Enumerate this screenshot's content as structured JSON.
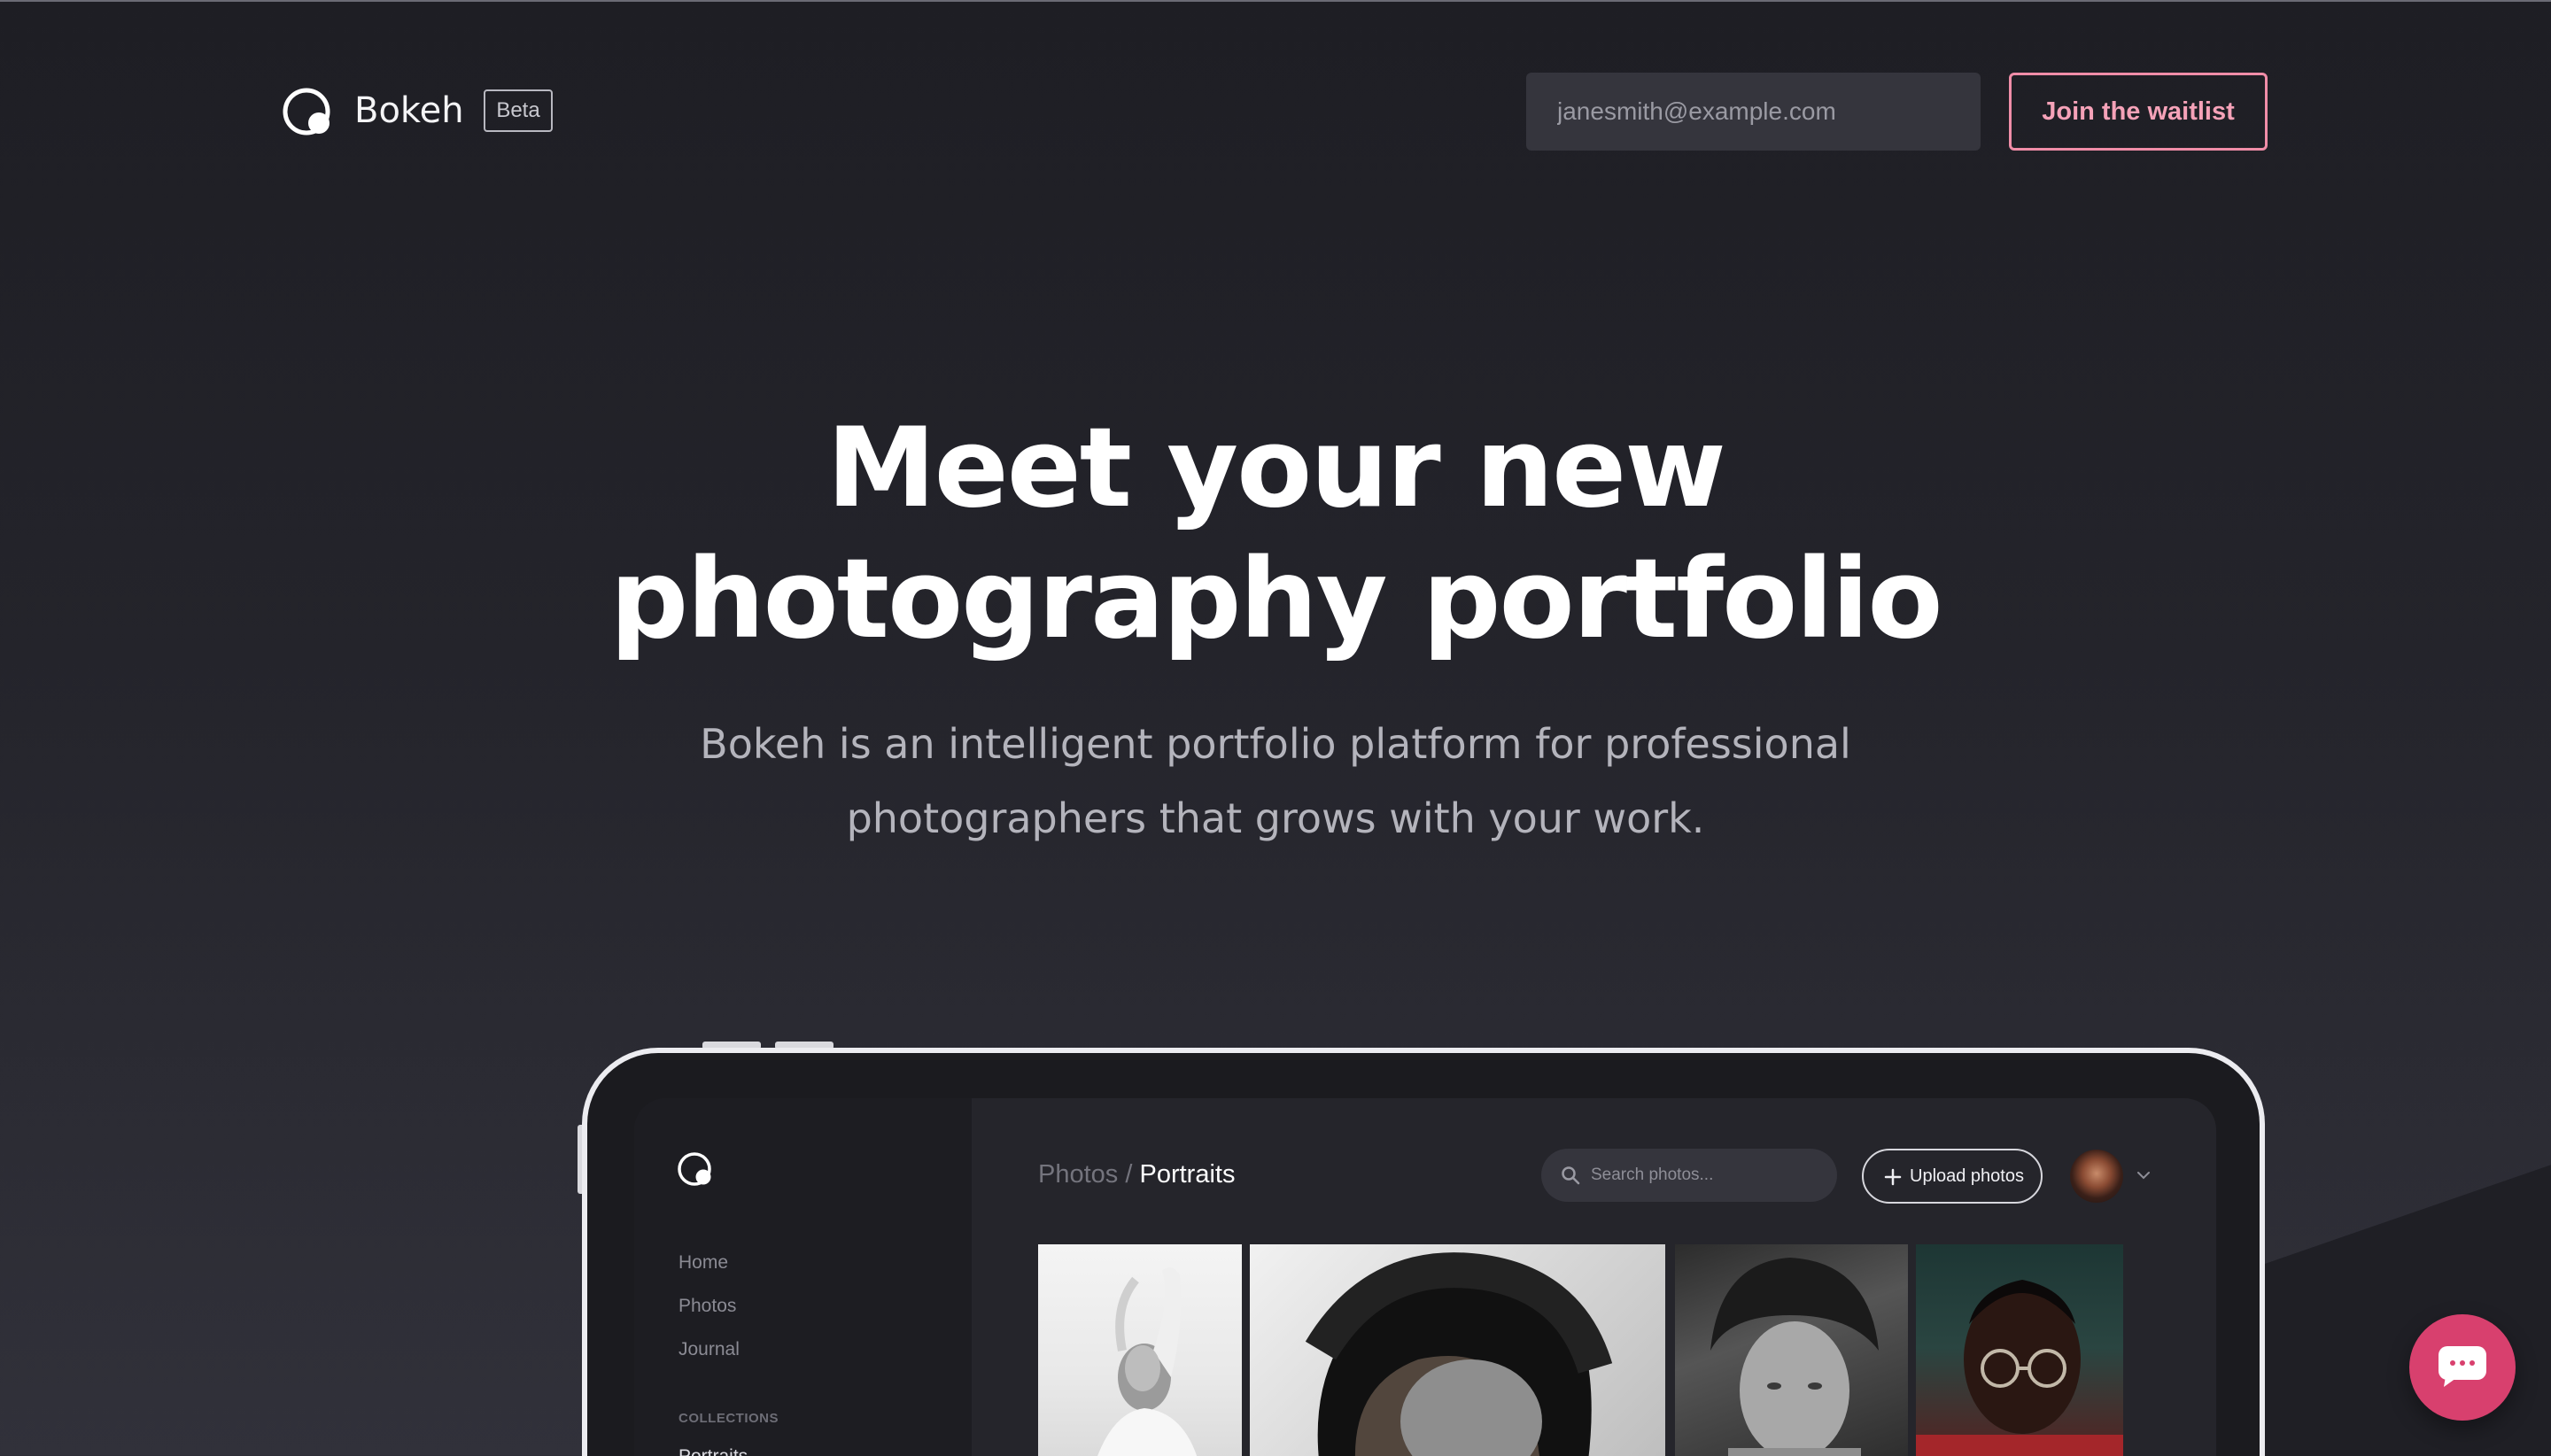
{
  "header": {
    "brand_name": "Bokeh",
    "beta_badge": "Beta",
    "email_placeholder": "janesmith@example.com",
    "cta_label": "Join the waitlist"
  },
  "hero": {
    "title_line1": "Meet your new",
    "title_line2": "photography portfolio",
    "subtitle_line1": "Bokeh is an intelligent portfolio platform for professional",
    "subtitle_line2": "photographers that grows with your work."
  },
  "app_preview": {
    "sidebar": {
      "nav": [
        "Home",
        "Photos",
        "Journal"
      ],
      "collections_heading": "COLLECTIONS",
      "collections_first": "Portraits"
    },
    "breadcrumb": {
      "parent": "Photos",
      "separator": "/",
      "current": "Portraits"
    },
    "search_placeholder": "Search photos...",
    "upload_label": "Upload photos"
  },
  "colors": {
    "accent": "#f08da8",
    "chat_button": "#d8406e",
    "background": "#1e1e24"
  },
  "icons": [
    "bokeh-logo-icon",
    "search-icon",
    "plus-icon",
    "chevron-down-icon",
    "chat-icon"
  ]
}
